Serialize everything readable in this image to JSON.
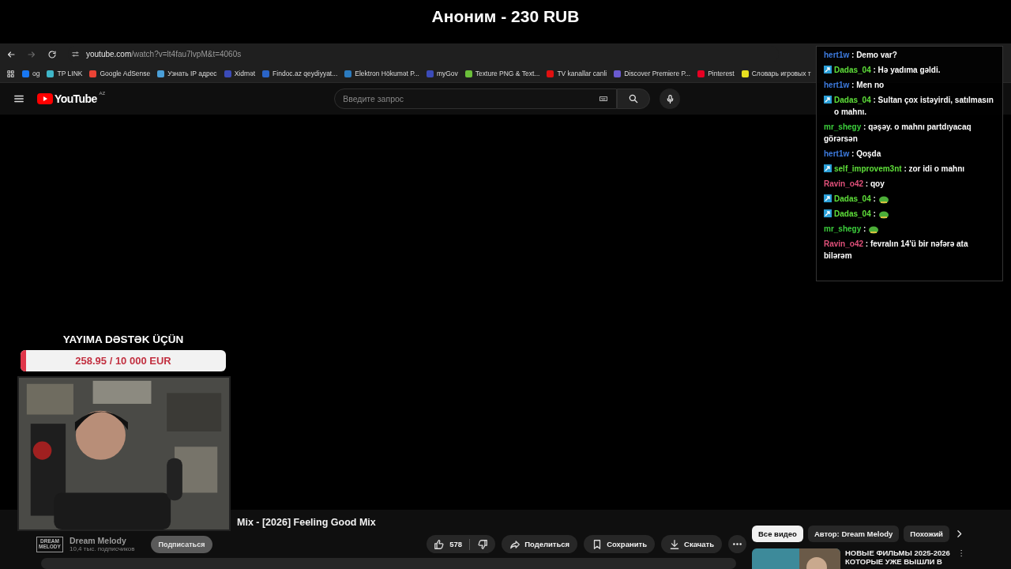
{
  "alert": {
    "title": "Аноним - 230 RUB"
  },
  "browser": {
    "url_host": "youtube.com",
    "url_path": "/watch?v=lt4fau7lvpM&t=4060s",
    "bookmarks": [
      {
        "label": "og",
        "color": "#1877f2"
      },
      {
        "label": "TP LINK",
        "color": "#3fb6c8"
      },
      {
        "label": "Google AdSense",
        "color": "#ea4335"
      },
      {
        "label": "Узнать IP адрес",
        "color": "#4a9fd8"
      },
      {
        "label": "Xidmət",
        "color": "#3b4bb8"
      },
      {
        "label": "Findoc.az qeydiyyat...",
        "color": "#2a64c8"
      },
      {
        "label": "Elektron Hökumət P...",
        "color": "#2b7bbf"
      },
      {
        "label": "myGov",
        "color": "#3b4bb8"
      },
      {
        "label": "Texture PNG & Text...",
        "color": "#6bbf3a"
      },
      {
        "label": "TV kanallar canli",
        "color": "#e01010"
      },
      {
        "label": "Discover Premiere P...",
        "color": "#6a5ad0"
      },
      {
        "label": "Pinterest",
        "color": "#e60023"
      },
      {
        "label": "Словарь игровых т",
        "color": "#e8e020"
      }
    ]
  },
  "youtube": {
    "logo": "YouTube",
    "region": "AZ",
    "search": {
      "placeholder": "Введите запрос"
    },
    "video_title": "Mix - [2026] Feeling Good Mix",
    "channel": {
      "logo": "DREAM MELODY",
      "name": "Dream Melody",
      "subscribers": "10,4 тыс. подписчиков",
      "subscribe": "Подписаться"
    },
    "likes": "578",
    "actions": [
      {
        "kind": "share",
        "label": "Поделиться"
      },
      {
        "kind": "save",
        "label": "Сохранить"
      },
      {
        "kind": "download",
        "label": "Скачать"
      }
    ],
    "chips": [
      {
        "label": "Все видео",
        "selected": true
      },
      {
        "label": "Автор: Dream Melody",
        "selected": false
      },
      {
        "label": "Похожий",
        "selected": false
      }
    ],
    "recommendation": {
      "title_lines": [
        "НОВЫЕ ФИЛЬМЫ 2025-2026",
        "КОТОРЫЕ УЖЕ ВЫШЛИ В"
      ]
    }
  },
  "goal": {
    "title": "YAYIMA DƏSTƏK ÜÇÜN",
    "reading": "258.95 / 10 000 EUR",
    "level": 0.026
  },
  "chat_separator": ":",
  "chat": [
    {
      "user": "hert1w",
      "color": "#3d7be0",
      "badge": false,
      "kind": "text",
      "text": "Demo var?"
    },
    {
      "user": "Dadas_04",
      "color": "#5fe03a",
      "badge": true,
      "kind": "text",
      "text": "Hə yadıma gəldi."
    },
    {
      "user": "hert1w",
      "color": "#3d7be0",
      "badge": false,
      "kind": "text",
      "text": "Men no"
    },
    {
      "user": "Dadas_04",
      "color": "#5fe03a",
      "badge": true,
      "kind": "text",
      "text": "Sultan çox istəyirdi, satılmasın o mahnı."
    },
    {
      "user": "mr_shegy",
      "color": "#3ccf3c",
      "badge": false,
      "kind": "text",
      "text": "qəşəy. o mahnı partdıyacaq görərsən"
    },
    {
      "user": "hert1w",
      "color": "#3d7be0",
      "badge": false,
      "kind": "text",
      "text": "Qoşda"
    },
    {
      "user": "self_improvem3nt",
      "color": "#5fe03a",
      "badge": true,
      "kind": "text",
      "text": "zor idi o mahnı"
    },
    {
      "user": "Ravin_o42",
      "color": "#e0507a",
      "badge": false,
      "kind": "text",
      "text": "qoy"
    },
    {
      "user": "Dadas_04",
      "color": "#5fe03a",
      "badge": true,
      "kind": "emote"
    },
    {
      "user": "Dadas_04",
      "color": "#5fe03a",
      "badge": true,
      "kind": "emote"
    },
    {
      "user": "mr_shegy",
      "color": "#3ccf3c",
      "badge": false,
      "kind": "emote"
    },
    {
      "user": "Ravin_o42",
      "color": "#e0507a",
      "badge": false,
      "kind": "text",
      "text": "fevralın 14'ü bir nəfərə ata bilərəm"
    }
  ]
}
